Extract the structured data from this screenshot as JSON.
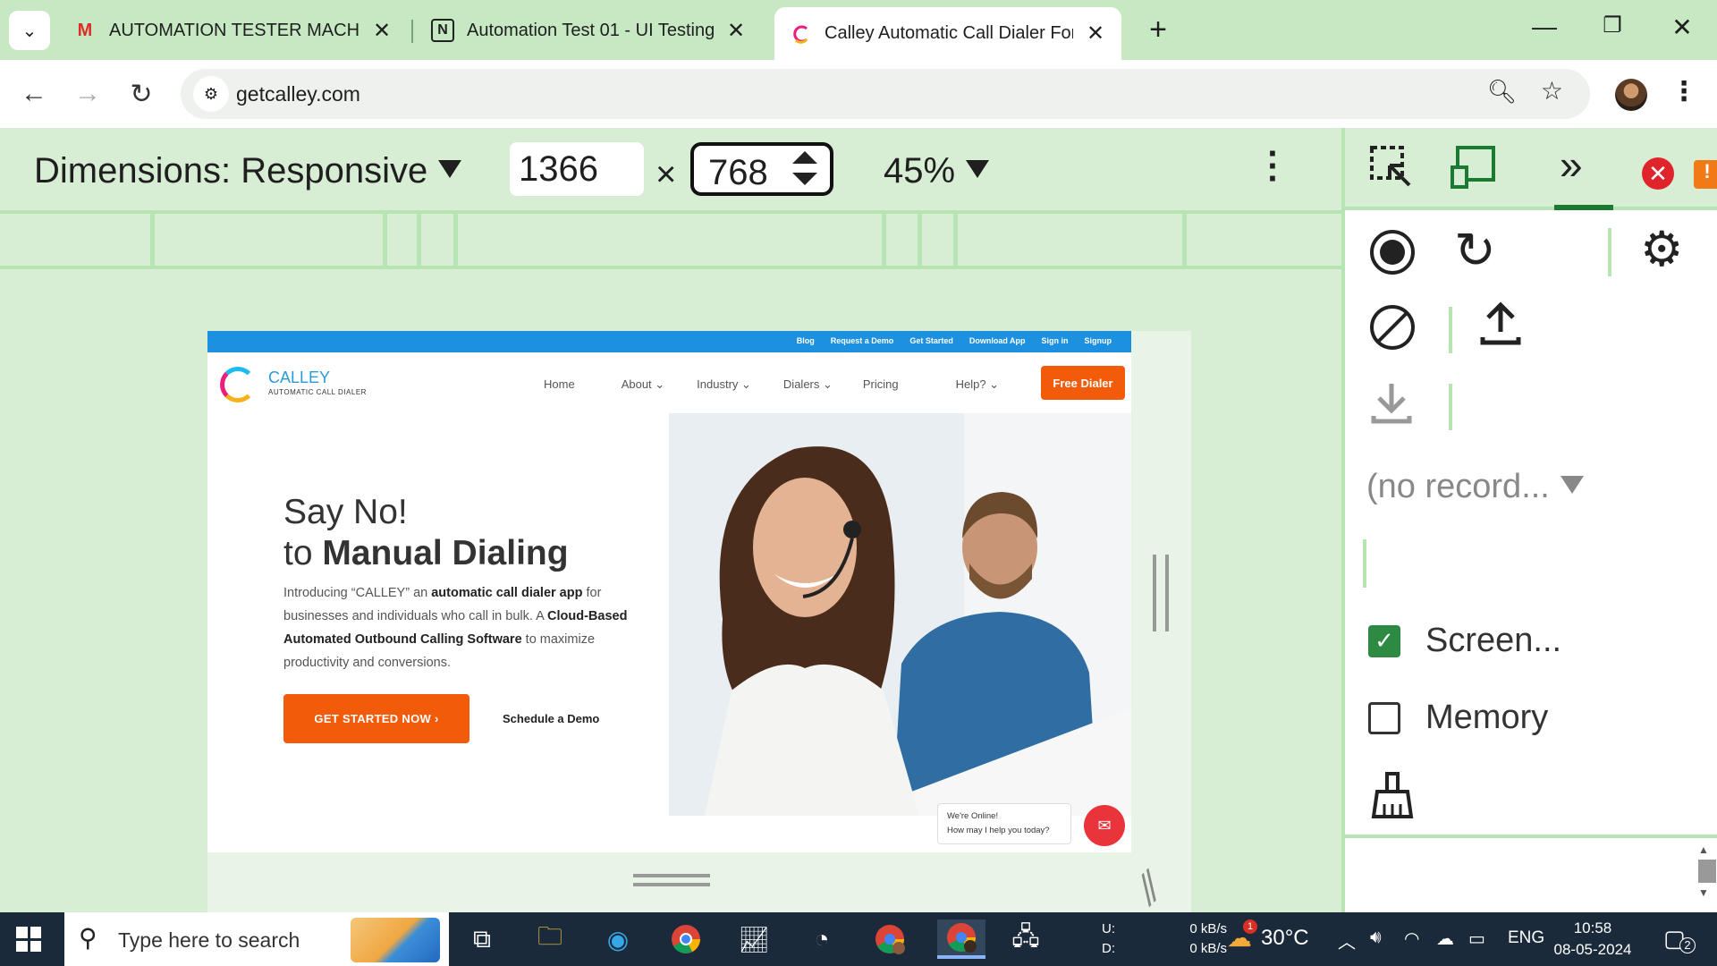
{
  "browser": {
    "tabs": [
      {
        "title": "AUTOMATION TESTER MACHINE T",
        "favicon": "gmail-icon"
      },
      {
        "title": "Automation Test 01 - UI Testing",
        "favicon": "notion-icon"
      },
      {
        "title": "Calley Automatic Call Dialer For Ar",
        "favicon": "calley-icon",
        "active": true
      }
    ],
    "url": "getcalley.com"
  },
  "device_toolbar": {
    "dimensions_label": "Dimensions: Responsive",
    "width": "1366",
    "height": "768",
    "times": "×",
    "zoom": "45%"
  },
  "site": {
    "top_links": [
      "Blog",
      "Request a Demo",
      "Get Started",
      "Download App",
      "Sign in",
      "Signup"
    ],
    "logo_name": "CALLEY",
    "logo_sub": "AUTOMATIC CALL DIALER",
    "nav": [
      "Home",
      "About ⌄",
      "Industry ⌄",
      "Dialers ⌄",
      "Pricing",
      "Help? ⌄"
    ],
    "free_dialer": "Free Dialer",
    "hero_line1": "Say No!",
    "hero_line2_prefix": "to ",
    "hero_line2_bold": "Manual Dialing",
    "hero_p1": "Introducing “CALLEY” an ",
    "hero_p1_bold": "automatic call dialer app",
    "hero_p2": " for businesses and individuals who call in bulk. A ",
    "hero_p3_bold": "Cloud-Based Automated Outbound Calling Software",
    "hero_p4": " to maximize productivity and conversions.",
    "cta": "GET STARTED NOW  ›",
    "demo": "Schedule a Demo",
    "chat_line1": "We're Online!",
    "chat_line2": "How may I help you today?"
  },
  "devtools": {
    "recording_select": "(no record...",
    "screenshots_label": "Screen...",
    "screenshots_checked": true,
    "memory_label": "Memory",
    "memory_checked": false
  },
  "taskbar": {
    "search_placeholder": "Type here to search",
    "upload_label": "U:",
    "download_label": "D:",
    "upload_speed": "0 kB/s",
    "download_speed": "0 kB/s",
    "temperature": "30°C",
    "weather_badge": "1",
    "language": "ENG",
    "time": "10:58",
    "date": "08-05-2024",
    "notifications": "2"
  },
  "colors": {
    "chrome_frame": "#c6e8c3",
    "brand_orange": "#f25b0a",
    "topbar_blue": "#1e90e0",
    "error_red": "#e0242c"
  }
}
